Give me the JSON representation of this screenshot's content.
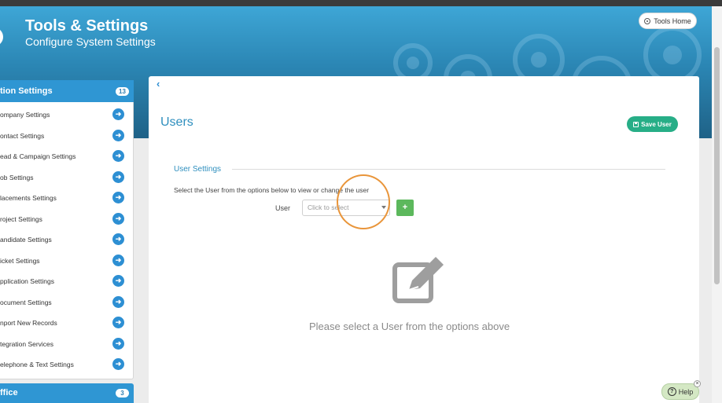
{
  "header": {
    "title": "Tools & Settings",
    "subtitle": "Configure System Settings",
    "tools_home_label": "Tools Home"
  },
  "sidebar": {
    "section1": {
      "label": "tion Settings",
      "count": "13"
    },
    "items": [
      {
        "label": "ompany Settings"
      },
      {
        "label": "ontact Settings"
      },
      {
        "label": "ead & Campaign Settings"
      },
      {
        "label": "ob Settings"
      },
      {
        "label": "lacements Settings"
      },
      {
        "label": "roject Settings"
      },
      {
        "label": "andidate Settings"
      },
      {
        "label": "icket Settings"
      },
      {
        "label": "pplication Settings"
      },
      {
        "label": "ocument Settings"
      },
      {
        "label": "nport New Records"
      },
      {
        "label": "tegration Services"
      },
      {
        "label": "elephone & Text Settings"
      }
    ],
    "item_arrow": "➜",
    "section2": {
      "label": "ffice",
      "count": "3"
    }
  },
  "main": {
    "back": "‹",
    "title": "Users",
    "save_label": "Save User",
    "section_title": "User Settings",
    "instruction": "Select the User from the options below to view or change the user",
    "user_label": "User",
    "user_placeholder": "Click to select",
    "add_label": "+",
    "empty_message": "Please select a User from the options above"
  },
  "help": {
    "label": "Help",
    "q": "?",
    "close": "×"
  },
  "colors": {
    "accent": "#2f96d3",
    "save": "#27ae87",
    "add": "#5cb85c",
    "highlight": "#e9953a"
  }
}
